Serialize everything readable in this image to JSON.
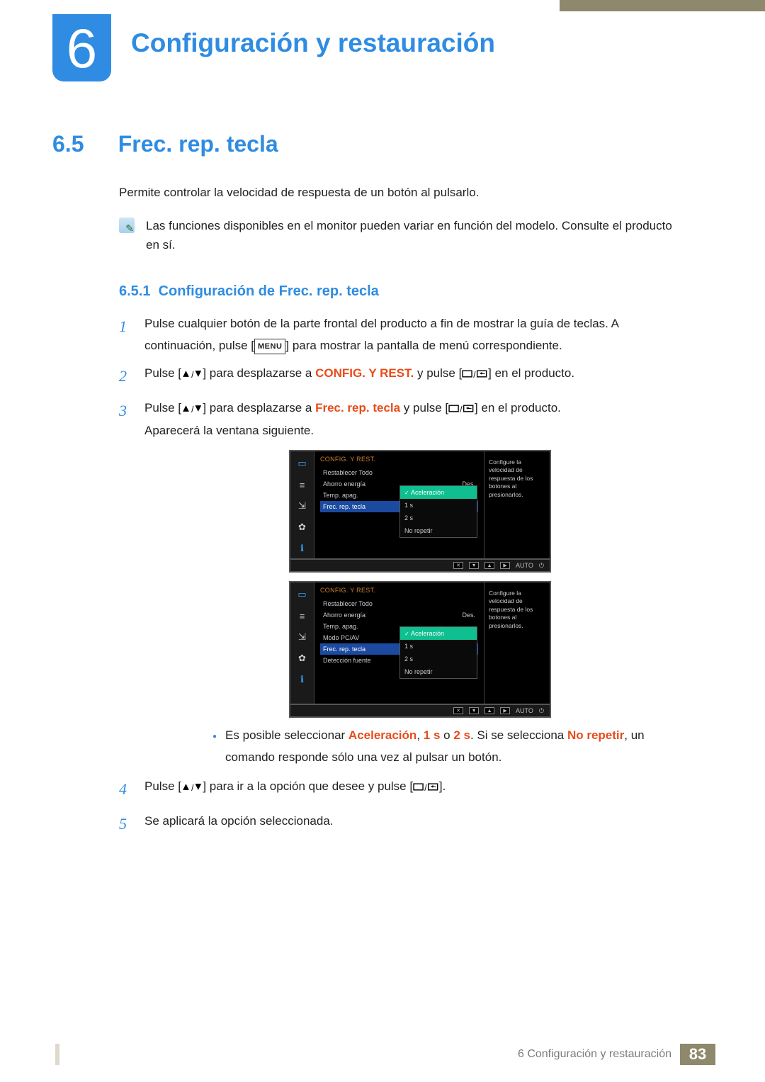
{
  "chapter": {
    "number": "6",
    "title": "Configuración y restauración"
  },
  "section": {
    "number": "6.5",
    "title": "Frec. rep. tecla",
    "intro": "Permite controlar la velocidad de respuesta de un botón al pulsarlo.",
    "note": "Las funciones disponibles en el monitor pueden variar en función del modelo. Consulte el producto en sí."
  },
  "subsection": {
    "number": "6.5.1",
    "title": "Configuración de Frec. rep. tecla"
  },
  "steps": {
    "s1a": "Pulse cualquier botón de la parte frontal del producto a fin de mostrar la guía de teclas. A continuación, pulse [",
    "s1b": "] para mostrar la pantalla de menú correspondiente.",
    "s2a": "Pulse [",
    "s2b": "] para desplazarse a ",
    "s2c": "CONFIG. Y REST.",
    "s2d": " y pulse [",
    "s2e": "] en el producto.",
    "s3a": "Pulse [",
    "s3b": "] para desplazarse a ",
    "s3c": "Frec. rep. tecla",
    "s3d": " y pulse [",
    "s3e": "] en el producto.",
    "s3f": "Aparecerá la ventana siguiente.",
    "s4a": "Pulse [",
    "s4b": "] para ir a la opción que desee y pulse [",
    "s4c": "].",
    "s5": "Se aplicará la opción seleccionada.",
    "bullet_a": "Es posible seleccionar ",
    "bullet_b": "Aceleración",
    "bullet_c": ", ",
    "bullet_d": "1 s",
    "bullet_e": " o ",
    "bullet_f": "2 s",
    "bullet_g": ". Si se selecciona ",
    "bullet_h": "No repetir",
    "bullet_i": ", un comando responde sólo una vez al pulsar un botón."
  },
  "keys": {
    "menu": "MENU"
  },
  "osd1": {
    "header": "CONFIG. Y REST.",
    "items": [
      "Restablecer Todo",
      "Ahorro energía",
      "Temp. apag.",
      "Frec. rep. tecla"
    ],
    "item_val_1": "Des.",
    "sub": [
      "Aceleración",
      "1 s",
      "2 s",
      "No repetir"
    ],
    "help": "Configure la velocidad de respuesta de los botones al presionarlos."
  },
  "osd2": {
    "header": "CONFIG. Y REST.",
    "items": [
      "Restablecer Todo",
      "Ahorro energía",
      "Temp. apag.",
      "Modo PC/AV",
      "Frec. rep. tecla",
      "Detección fuente"
    ],
    "item_val_1": "Des.",
    "sub": [
      "Aceleración",
      "1 s",
      "2 s",
      "No repetir"
    ],
    "help": "Configure la velocidad de respuesta de los botones al presionarlos."
  },
  "osd_footer": {
    "auto": "AUTO"
  },
  "footer": {
    "title": "6 Configuración y restauración",
    "page": "83"
  }
}
